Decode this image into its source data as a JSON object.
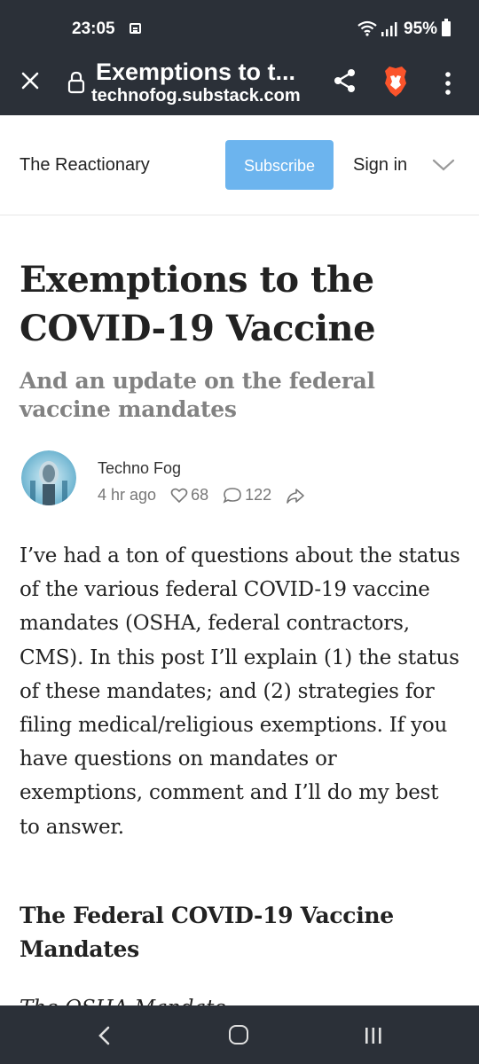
{
  "status_bar": {
    "time": "23:05",
    "battery": "95%"
  },
  "browser": {
    "tab_title": "Exemptions to t...",
    "url": "technofog.substack.com",
    "icons": [
      "close-icon",
      "lock-icon",
      "share-icon",
      "brave-shields-icon",
      "more-menu-icon"
    ]
  },
  "site_header": {
    "site_name": "The Reactionary",
    "subscribe_label": "Subscribe",
    "signin_label": "Sign in",
    "accent_color": "#6cb4ee"
  },
  "article": {
    "title": "Exemptions to the COVID-19 Vaccine",
    "subtitle": "And an update on the federal vaccine mandates",
    "author": "Techno Fog",
    "posted": "4 hr ago",
    "likes": "68",
    "comments": "122",
    "body": "I’ve had a ton of questions about the status of the various federal COVID-19 vaccine mandates (OSHA, federal contractors, CMS). In this post I’ll explain (1) the status of these mandates; and (2) strategies for filing medical/religious exemptions. If you have questions on mandates or exemptions, comment and I’ll do my best to answer.",
    "section_heading": "The Federal COVID-19 Vaccine Mandates",
    "sub_heading": "The OSHA Mandate"
  },
  "nav_bar": {
    "icons": [
      "back-icon",
      "home-icon",
      "recents-icon"
    ]
  }
}
